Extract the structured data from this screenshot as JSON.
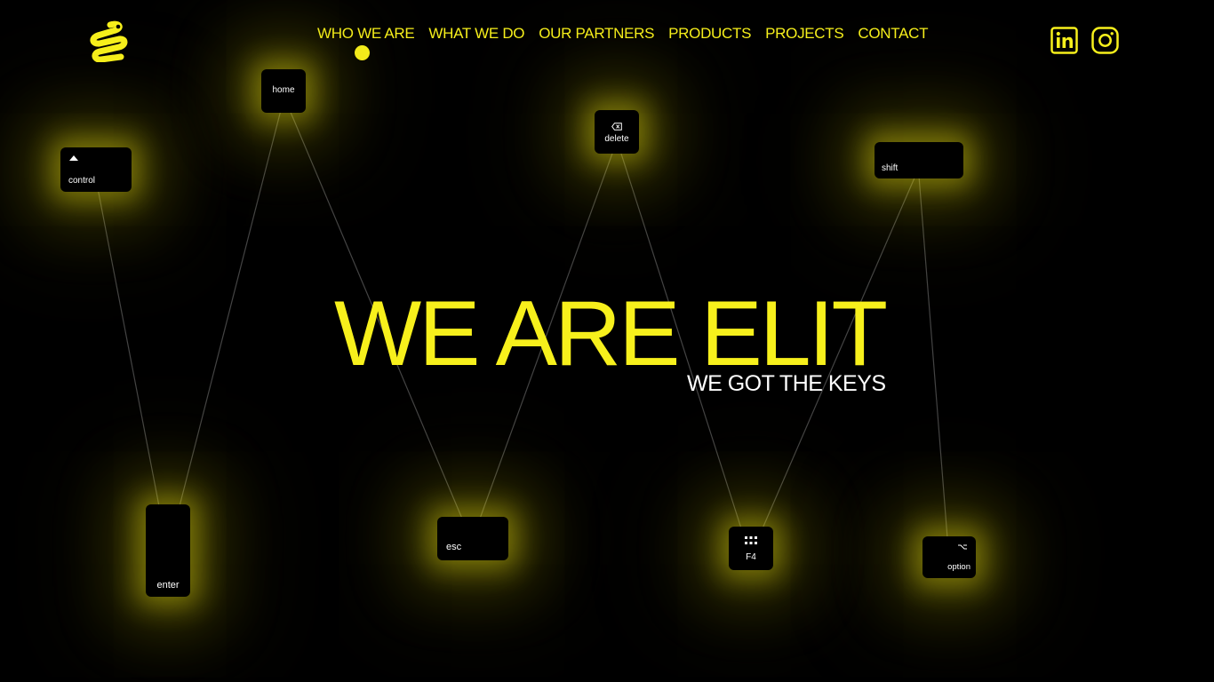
{
  "header": {
    "logo_icon": "elit-squiggle-logo-icon",
    "nav": [
      {
        "label": "WHO WE ARE",
        "active": true
      },
      {
        "label": "WHAT WE DO"
      },
      {
        "label": "OUR PARTNERS"
      },
      {
        "label": "PRODUCTS"
      },
      {
        "label": "PROJECTS"
      },
      {
        "label": "CONTACT"
      }
    ],
    "social": [
      {
        "icon": "linkedin-icon"
      },
      {
        "icon": "instagram-icon"
      }
    ]
  },
  "hero": {
    "title": "WE ARE ELIT",
    "subtitle": "WE GOT THE KEYS"
  },
  "keys": {
    "home": {
      "label": "home"
    },
    "control": {
      "label": "control",
      "icon": "caret-up-icon"
    },
    "delete": {
      "label": "delete",
      "icon": "delete-icon"
    },
    "shift": {
      "label": "shift"
    },
    "enter": {
      "label": "enter"
    },
    "esc": {
      "label": "esc"
    },
    "f4": {
      "label": "F4",
      "icon": "launchpad-grid-icon"
    },
    "option": {
      "label": "option",
      "icon": "option-symbol-icon"
    }
  },
  "colors": {
    "accent": "#f7f01c",
    "background": "#000000",
    "line": "#3a3a3a",
    "key_glow": "#e6dc14"
  }
}
